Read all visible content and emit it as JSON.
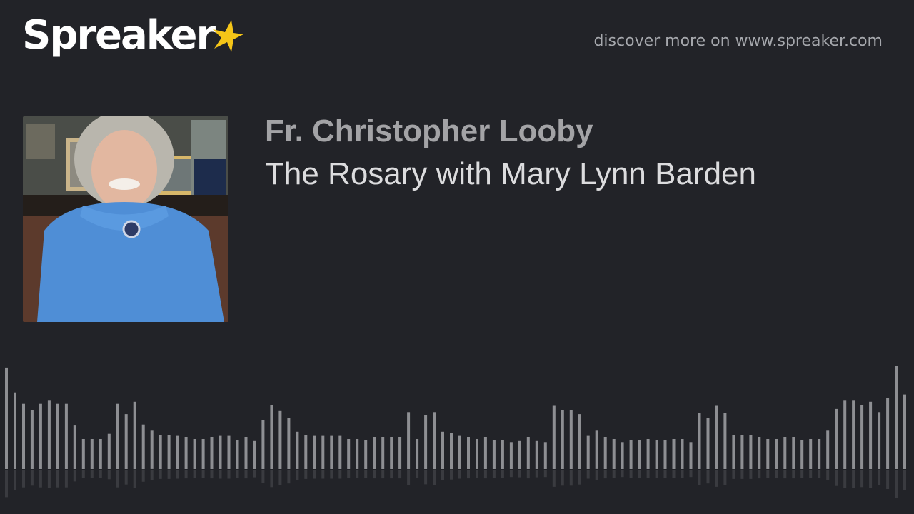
{
  "header": {
    "logo_text": "Spreaker",
    "tagline": "discover more on www.spreaker.com"
  },
  "episode": {
    "author": "Fr. Christopher Looby",
    "title": "The Rosary with Mary Lynn Barden"
  },
  "colors": {
    "background": "#222328",
    "logo_star": "#f5c518",
    "waveform_bar": "#8e8f93",
    "waveform_reflection": "#3a3b40"
  },
  "waveform": {
    "levels": [
      0.98,
      0.74,
      0.63,
      0.57,
      0.63,
      0.66,
      0.63,
      0.63,
      0.42,
      0.29,
      0.29,
      0.29,
      0.34,
      0.63,
      0.53,
      0.65,
      0.43,
      0.37,
      0.33,
      0.33,
      0.32,
      0.31,
      0.29,
      0.29,
      0.31,
      0.32,
      0.32,
      0.28,
      0.31,
      0.27,
      0.47,
      0.62,
      0.56,
      0.49,
      0.36,
      0.33,
      0.32,
      0.32,
      0.32,
      0.32,
      0.29,
      0.29,
      0.28,
      0.31,
      0.31,
      0.31,
      0.31,
      0.55,
      0.29,
      0.52,
      0.55,
      0.36,
      0.35,
      0.32,
      0.31,
      0.29,
      0.31,
      0.28,
      0.28,
      0.26,
      0.27,
      0.31,
      0.27,
      0.26,
      0.61,
      0.57,
      0.57,
      0.53,
      0.32,
      0.37,
      0.31,
      0.29,
      0.26,
      0.28,
      0.28,
      0.29,
      0.28,
      0.28,
      0.29,
      0.29,
      0.26,
      0.54,
      0.49,
      0.61,
      0.54,
      0.33,
      0.33,
      0.33,
      0.31,
      0.29,
      0.29,
      0.31,
      0.31,
      0.28,
      0.29,
      0.29,
      0.37,
      0.58,
      0.66,
      0.66,
      0.62,
      0.65,
      0.55,
      0.69,
      1.0,
      0.72
    ]
  }
}
